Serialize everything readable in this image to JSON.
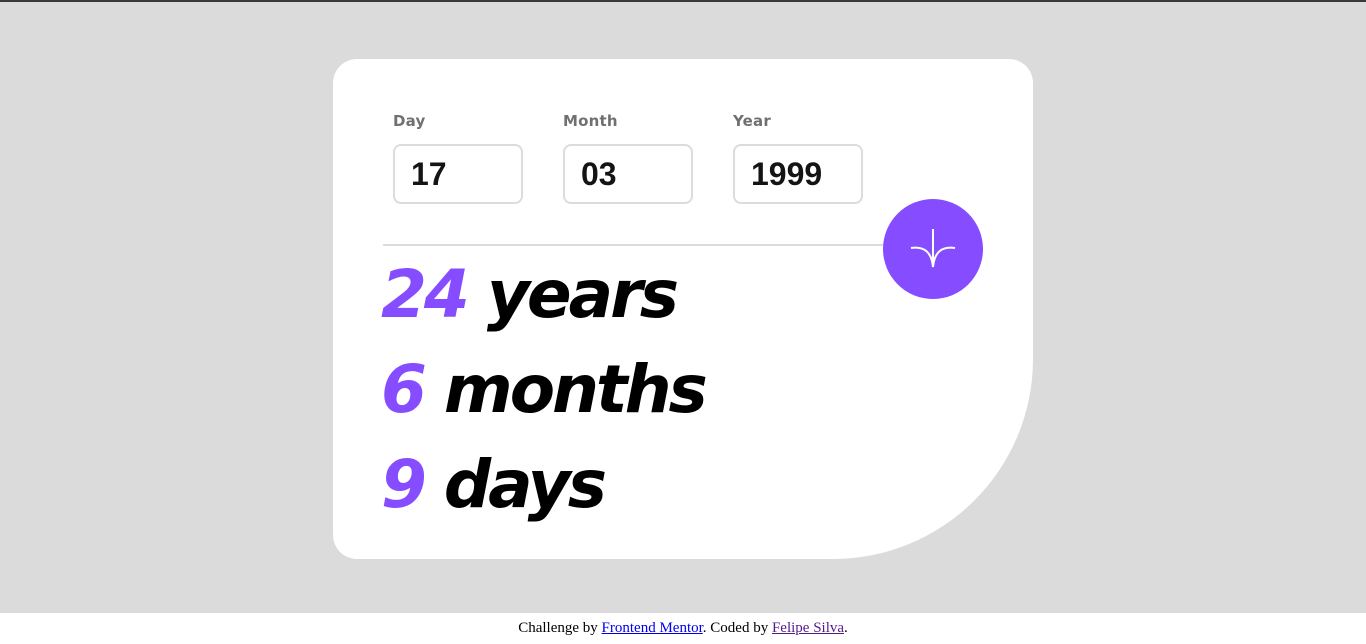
{
  "form": {
    "fields": [
      {
        "label": "Day",
        "value": "17"
      },
      {
        "label": "Month",
        "value": "03"
      },
      {
        "label": "Year",
        "value": "1999"
      }
    ],
    "submit_icon": "arrow-down-icon"
  },
  "results": {
    "years": {
      "number": "24",
      "unit": "years"
    },
    "months": {
      "number": "6",
      "unit": "months"
    },
    "days": {
      "number": "9",
      "unit": "days"
    }
  },
  "footer": {
    "prefix": "Challenge by ",
    "link1": "Frontend Mentor",
    "middle": ". Coded by ",
    "link2": "Felipe Silva",
    "suffix": "."
  },
  "colors": {
    "accent": "#854dff",
    "background": "#dbdbdb",
    "card": "#ffffff",
    "label": "#716f6f"
  }
}
